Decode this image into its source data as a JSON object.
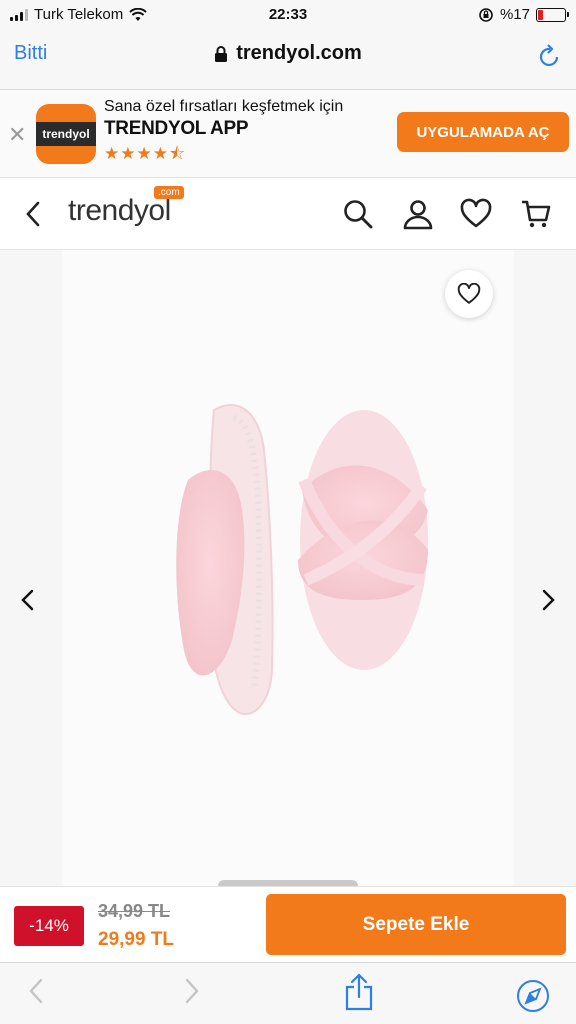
{
  "status_bar": {
    "carrier": "Turk Telekom",
    "time": "22:33",
    "battery": "%17",
    "battery_level": 0.17
  },
  "browser": {
    "done_label": "Bitti",
    "url": "trendyol.com"
  },
  "app_banner": {
    "subtitle": "Sana özel fırsatları keşfetmek için",
    "title": "TRENDYOL APP",
    "icon_text": "trendyol",
    "rating_stars": "★★★★⯪",
    "rating": 4.5,
    "open_button": "UYGULAMADA AÇ"
  },
  "header": {
    "logo_text": "trendyol",
    "logo_badge": ".com"
  },
  "product": {
    "discount": "-14%",
    "old_price": "34,99 TL",
    "new_price": "29,99 TL",
    "add_to_cart": "Sepete Ekle"
  },
  "colors": {
    "brand_orange": "#f27a1a",
    "discount_red": "#d0112b",
    "safari_blue": "#2f7fe0"
  }
}
